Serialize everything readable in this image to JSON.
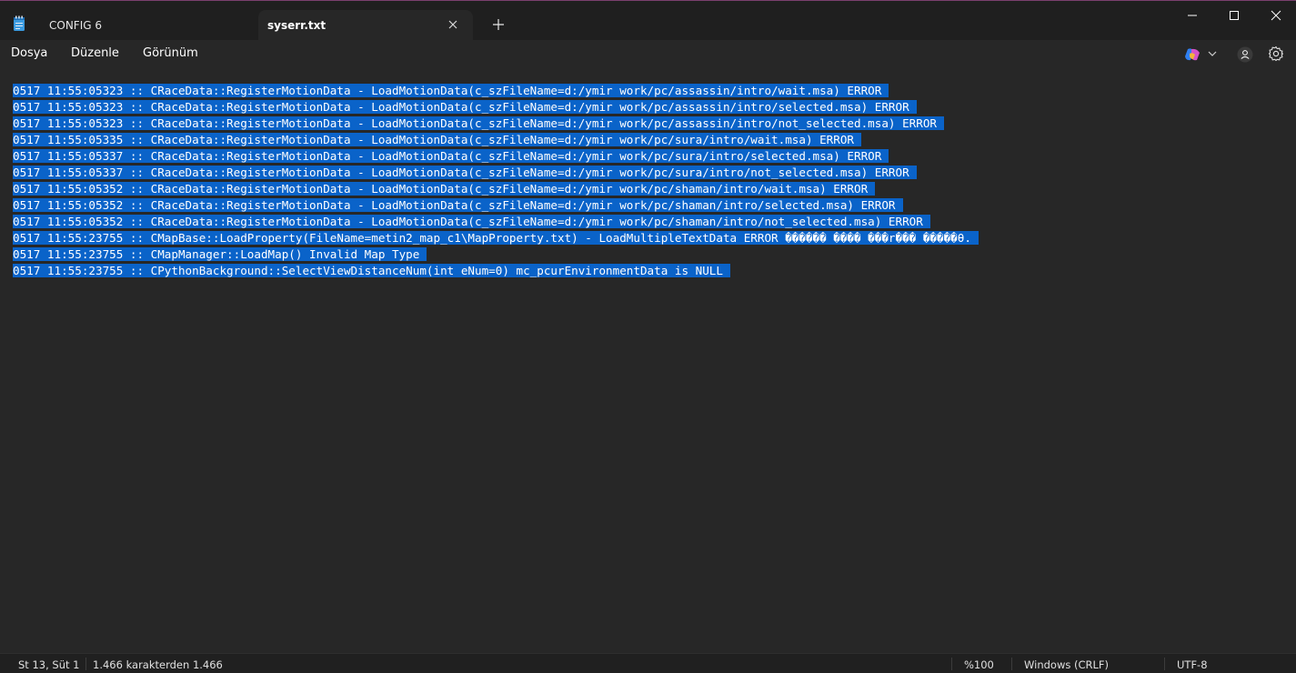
{
  "tabs": [
    {
      "label": "CONFIG 6",
      "active": false
    },
    {
      "label": "syserr.txt",
      "active": true
    }
  ],
  "menu": {
    "file": "Dosya",
    "edit": "Düzenle",
    "view": "Görünüm"
  },
  "editor": {
    "lines": [
      "0517 11:55:05323 :: CRaceData::RegisterMotionData - LoadMotionData(c_szFileName=d:/ymir work/pc/assassin/intro/wait.msa) ERROR",
      "0517 11:55:05323 :: CRaceData::RegisterMotionData - LoadMotionData(c_szFileName=d:/ymir work/pc/assassin/intro/selected.msa) ERROR",
      "0517 11:55:05323 :: CRaceData::RegisterMotionData - LoadMotionData(c_szFileName=d:/ymir work/pc/assassin/intro/not_selected.msa) ERROR",
      "0517 11:55:05335 :: CRaceData::RegisterMotionData - LoadMotionData(c_szFileName=d:/ymir work/pc/sura/intro/wait.msa) ERROR",
      "0517 11:55:05337 :: CRaceData::RegisterMotionData - LoadMotionData(c_szFileName=d:/ymir work/pc/sura/intro/selected.msa) ERROR",
      "0517 11:55:05337 :: CRaceData::RegisterMotionData - LoadMotionData(c_szFileName=d:/ymir work/pc/sura/intro/not_selected.msa) ERROR",
      "0517 11:55:05352 :: CRaceData::RegisterMotionData - LoadMotionData(c_szFileName=d:/ymir work/pc/shaman/intro/wait.msa) ERROR",
      "0517 11:55:05352 :: CRaceData::RegisterMotionData - LoadMotionData(c_szFileName=d:/ymir work/pc/shaman/intro/selected.msa) ERROR",
      "0517 11:55:05352 :: CRaceData::RegisterMotionData - LoadMotionData(c_szFileName=d:/ymir work/pc/shaman/intro/not_selected.msa) ERROR",
      "0517 11:55:23755 :: CMapBase::LoadProperty(FileName=metin2_map_c1\\MapProperty.txt) - LoadMultipleTextData ERROR ������ ���� ���r��� �����θ.",
      "0517 11:55:23755 :: CMapManager::LoadMap() Invalid Map Type",
      "0517 11:55:23755 :: CPythonBackground::SelectViewDistanceNum(int eNum=0) mc_pcurEnvironmentData is NULL"
    ]
  },
  "status": {
    "position": "St 13, Süt 1",
    "char_count": "1.466 karakterden 1.466",
    "zoom": "%100",
    "line_ending": "Windows (CRLF)",
    "encoding": "UTF-8"
  },
  "colors": {
    "selection": "#0a63c9",
    "background": "#272727",
    "titlebar": "#1f1f1f"
  },
  "icons": [
    "notepad-icon",
    "close-icon",
    "plus-icon",
    "minimize-icon",
    "maximize-icon",
    "window-close-icon",
    "copilot-icon",
    "chevron-down-icon",
    "account-icon",
    "gear-icon"
  ]
}
